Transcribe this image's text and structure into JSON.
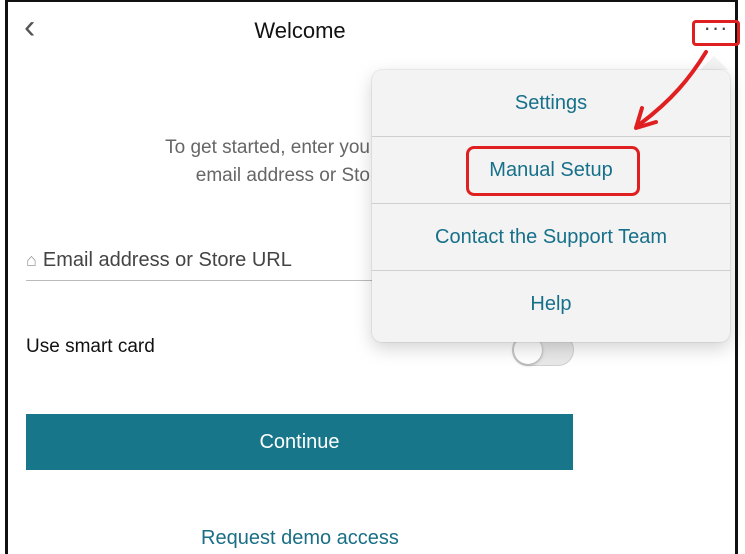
{
  "header": {
    "title": "Welcome",
    "back_icon": "chevron-left-icon",
    "more_icon": "more-icon"
  },
  "intro": {
    "line1": "To get started, enter you",
    "line2": "email address or Sto"
  },
  "email_field": {
    "placeholder": "Email address or Store URL",
    "icon": "home-icon"
  },
  "smart_card": {
    "label": "Use smart card",
    "enabled": false
  },
  "continue_button": {
    "label": "Continue"
  },
  "demo_link": {
    "label": "Request demo access"
  },
  "menu": {
    "items": [
      {
        "label": "Settings"
      },
      {
        "label": "Manual Setup"
      },
      {
        "label": "Contact the Support Team"
      },
      {
        "label": "Help"
      }
    ]
  },
  "colors": {
    "accent": "#17768a",
    "annotation": "#e02020",
    "link": "#1a6f86"
  }
}
